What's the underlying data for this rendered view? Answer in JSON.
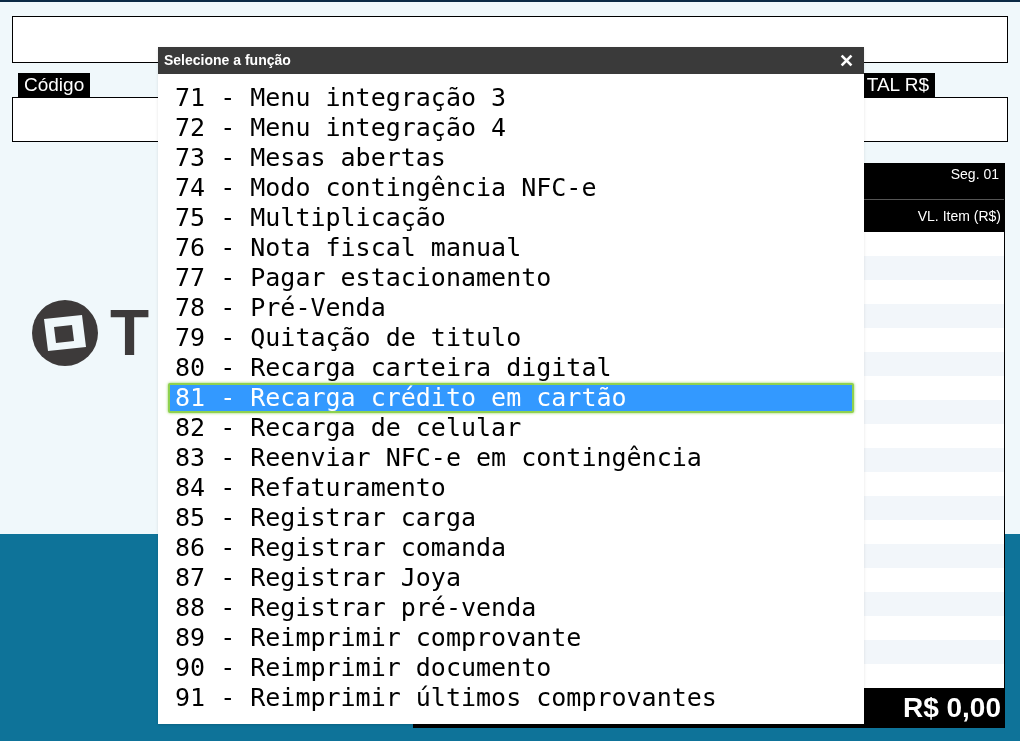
{
  "form": {
    "code_label": "Código",
    "total_label": "TAL R$"
  },
  "logo": {
    "text": "T"
  },
  "items_panel": {
    "segment": "Seg. 01",
    "columns": [
      "VL. Item (R$)"
    ],
    "total": "R$ 0,00"
  },
  "dialog": {
    "title": "Selecione a função",
    "close": "✕",
    "items": [
      {
        "label": "71 - Menu integração 3",
        "selected": false
      },
      {
        "label": "72 - Menu integração 4",
        "selected": false
      },
      {
        "label": "73 - Mesas abertas",
        "selected": false
      },
      {
        "label": "74 - Modo contingência NFC-e",
        "selected": false
      },
      {
        "label": "75 - Multiplicação",
        "selected": false
      },
      {
        "label": "76 - Nota fiscal manual",
        "selected": false
      },
      {
        "label": "77 - Pagar estacionamento",
        "selected": false
      },
      {
        "label": "78 - Pré-Venda",
        "selected": false
      },
      {
        "label": "79 - Quitação de titulo",
        "selected": false
      },
      {
        "label": "80 - Recarga carteira digital",
        "selected": false
      },
      {
        "label": "81 - Recarga crédito em cartão",
        "selected": true
      },
      {
        "label": "82 - Recarga de celular",
        "selected": false
      },
      {
        "label": "83 - Reenviar NFC-e em contingência",
        "selected": false
      },
      {
        "label": "84 - Refaturamento",
        "selected": false
      },
      {
        "label": "85 - Registrar carga",
        "selected": false
      },
      {
        "label": "86 - Registrar comanda",
        "selected": false
      },
      {
        "label": "87 - Registrar Joya",
        "selected": false
      },
      {
        "label": "88 - Registrar pré-venda",
        "selected": false
      },
      {
        "label": "89 - Reimprimir comprovante",
        "selected": false
      },
      {
        "label": "90 - Reimprimir documento",
        "selected": false
      },
      {
        "label": "91 - Reimprimir últimos comprovantes",
        "selected": false
      }
    ]
  }
}
